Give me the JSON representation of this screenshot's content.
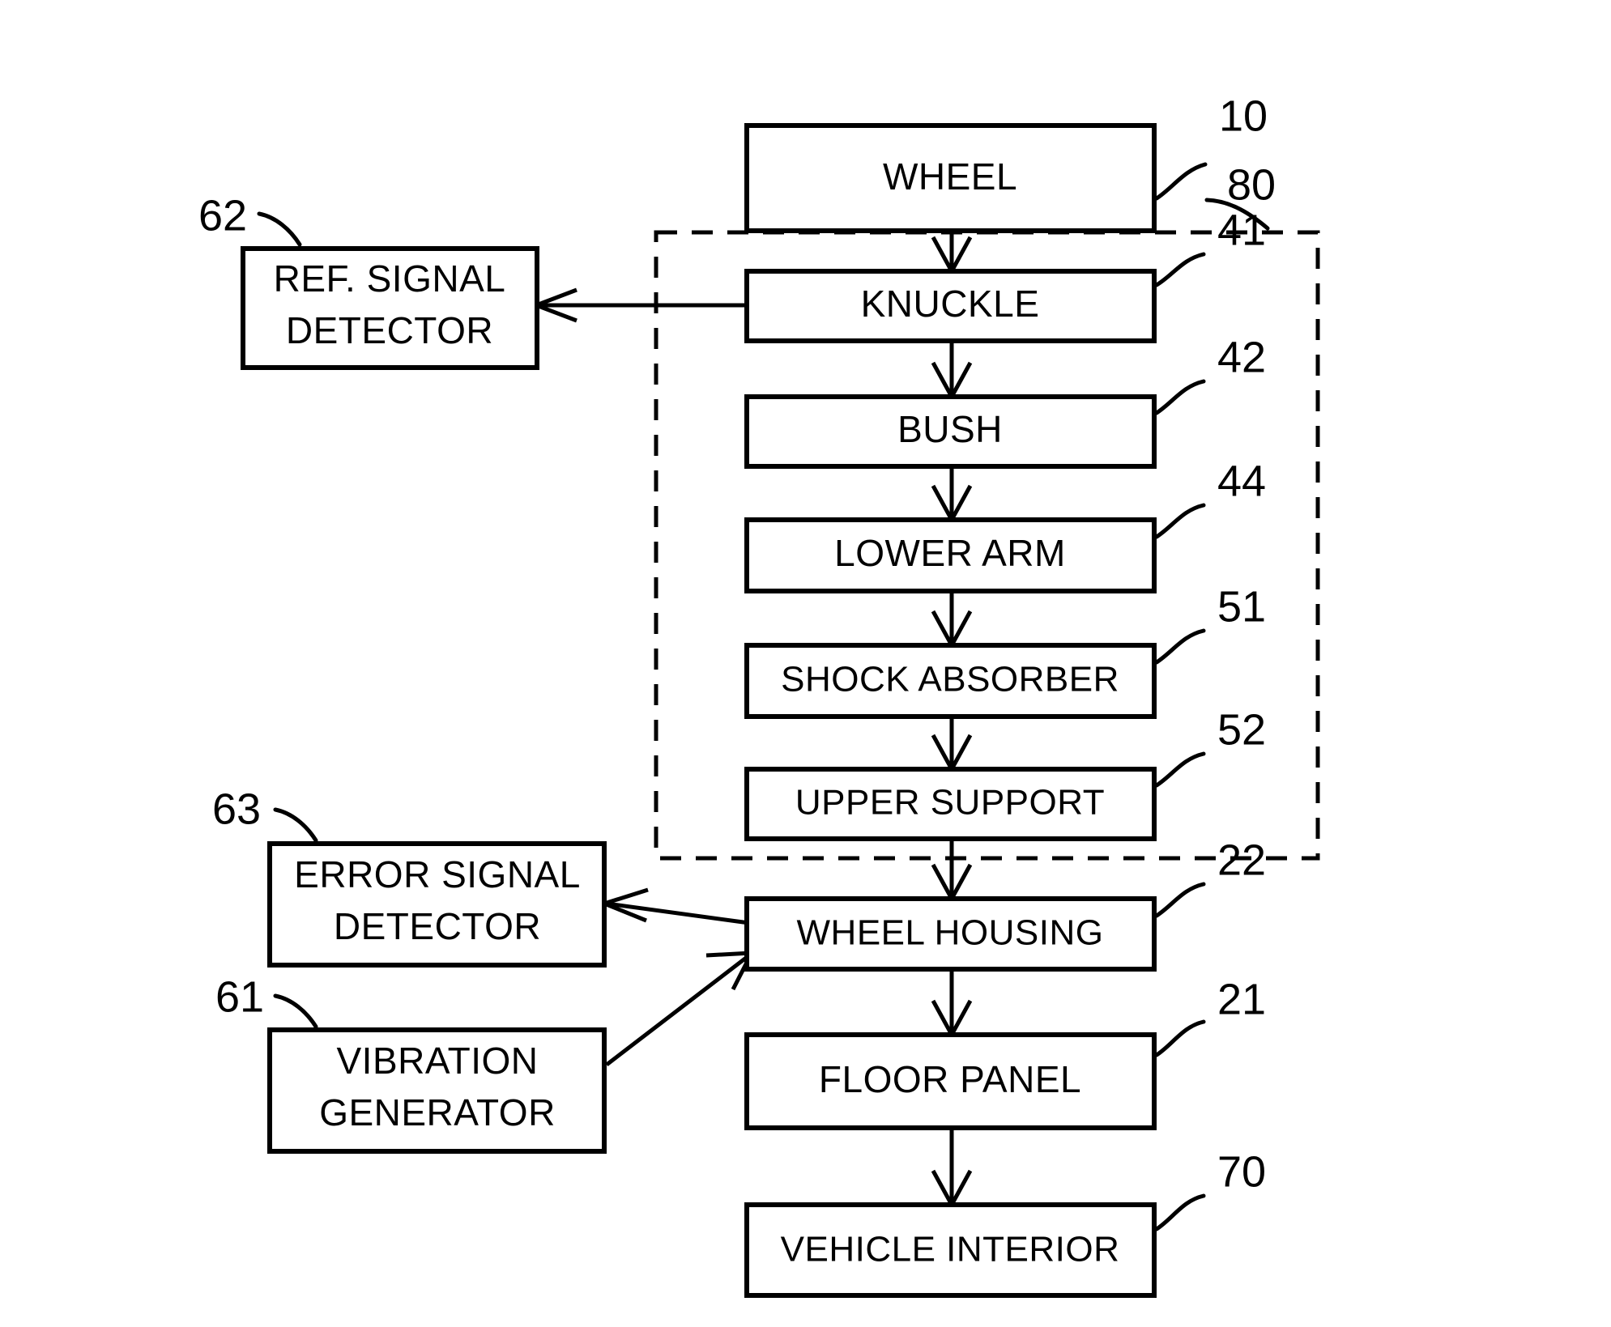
{
  "figure": {
    "type": "patent-block-diagram",
    "title": "Vehicle vibration control block diagram"
  },
  "boxes": [
    {
      "id": "wheel",
      "label": "WHEEL",
      "ref": "10",
      "lines": [
        "WHEEL"
      ]
    },
    {
      "id": "knuckle",
      "label": "KNUCKLE",
      "ref": "41",
      "lines": [
        "KNUCKLE"
      ]
    },
    {
      "id": "bush",
      "label": "BUSH",
      "ref": "42",
      "lines": [
        "BUSH"
      ]
    },
    {
      "id": "lower-arm",
      "label": "LOWER ARM",
      "ref": "44",
      "lines": [
        "LOWER ARM"
      ]
    },
    {
      "id": "shock",
      "label": "SHOCK ABSORBER",
      "ref": "51",
      "lines": [
        "SHOCK ABSORBER"
      ]
    },
    {
      "id": "upper",
      "label": "UPPER SUPPORT",
      "ref": "52",
      "lines": [
        "UPPER SUPPORT"
      ]
    },
    {
      "id": "wheel-house",
      "label": "WHEEL HOUSING",
      "ref": "22",
      "lines": [
        "WHEEL HOUSING"
      ]
    },
    {
      "id": "floor",
      "label": "FLOOR PANEL",
      "ref": "21",
      "lines": [
        "FLOOR PANEL"
      ]
    },
    {
      "id": "interior",
      "label": "VEHICLE INTERIOR",
      "ref": "70",
      "lines": [
        "VEHICLE INTERIOR"
      ]
    },
    {
      "id": "ref-detector",
      "label": "REF. SIGNAL DETECTOR",
      "ref": "62",
      "lines": [
        "REF. SIGNAL",
        "DETECTOR"
      ]
    },
    {
      "id": "err-detector",
      "label": "ERROR SIGNAL DETECTOR",
      "ref": "63",
      "lines": [
        "ERROR SIGNAL",
        "DETECTOR"
      ]
    },
    {
      "id": "vib-gen",
      "label": "VIBRATION GENERATOR",
      "ref": "61",
      "lines": [
        "VIBRATION",
        "GENERATOR"
      ]
    }
  ],
  "group": {
    "id": "suspension-group",
    "ref": "80",
    "style": "dashed"
  },
  "labels": {
    "wheel": "WHEEL",
    "knuckle": "KNUCKLE",
    "bush": "BUSH",
    "lower_arm": "LOWER ARM",
    "shock_absorber": "SHOCK ABSORBER",
    "upper_support": "UPPER SUPPORT",
    "wheel_housing": "WHEEL HOUSING",
    "floor_panel": "FLOOR PANEL",
    "vehicle_interior": "VEHICLE INTERIOR",
    "ref_signal_1": "REF. SIGNAL",
    "ref_signal_2": "DETECTOR",
    "error_signal_1": "ERROR SIGNAL",
    "error_signal_2": "DETECTOR",
    "vibration_1": "VIBRATION",
    "vibration_2": "GENERATOR"
  },
  "refs": {
    "wheel": "10",
    "knuckle": "41",
    "bush": "42",
    "lower_arm": "44",
    "shock_absorber": "51",
    "upper_support": "52",
    "wheel_housing": "22",
    "floor_panel": "21",
    "vehicle_interior": "70",
    "ref_detector": "62",
    "error_detector": "63",
    "vibration_generator": "61",
    "group": "80"
  },
  "connections": [
    {
      "from": "wheel",
      "to": "knuckle",
      "kind": "arrow-down"
    },
    {
      "from": "knuckle",
      "to": "bush",
      "kind": "arrow-down"
    },
    {
      "from": "bush",
      "to": "lower-arm",
      "kind": "arrow-down"
    },
    {
      "from": "lower-arm",
      "to": "shock",
      "kind": "arrow-down"
    },
    {
      "from": "shock",
      "to": "upper",
      "kind": "arrow-down"
    },
    {
      "from": "upper",
      "to": "wheel-house",
      "kind": "arrow-down"
    },
    {
      "from": "wheel-house",
      "to": "floor",
      "kind": "arrow-down"
    },
    {
      "from": "floor",
      "to": "interior",
      "kind": "arrow-down"
    },
    {
      "from": "knuckle",
      "to": "ref-detector",
      "kind": "arrow-left"
    },
    {
      "from": "wheel-house",
      "to": "err-detector",
      "kind": "arrow-diagonal-left"
    },
    {
      "from": "vib-gen",
      "to": "wheel-house",
      "kind": "arrow-diagonal-right"
    }
  ],
  "colors": {
    "stroke": "#000000",
    "background": "#ffffff"
  }
}
